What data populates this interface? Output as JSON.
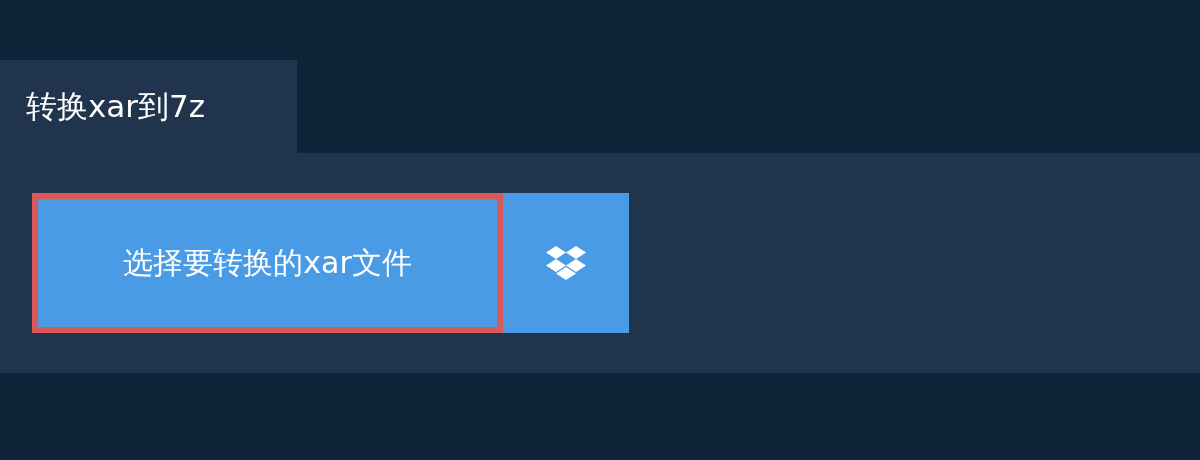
{
  "tab": {
    "label": "转换xar到7z"
  },
  "buttons": [
    {
      "kind": "file",
      "label": "选择要转换的xar文件",
      "focused": true
    },
    {
      "kind": "dropbox",
      "focused": false
    }
  ]
}
